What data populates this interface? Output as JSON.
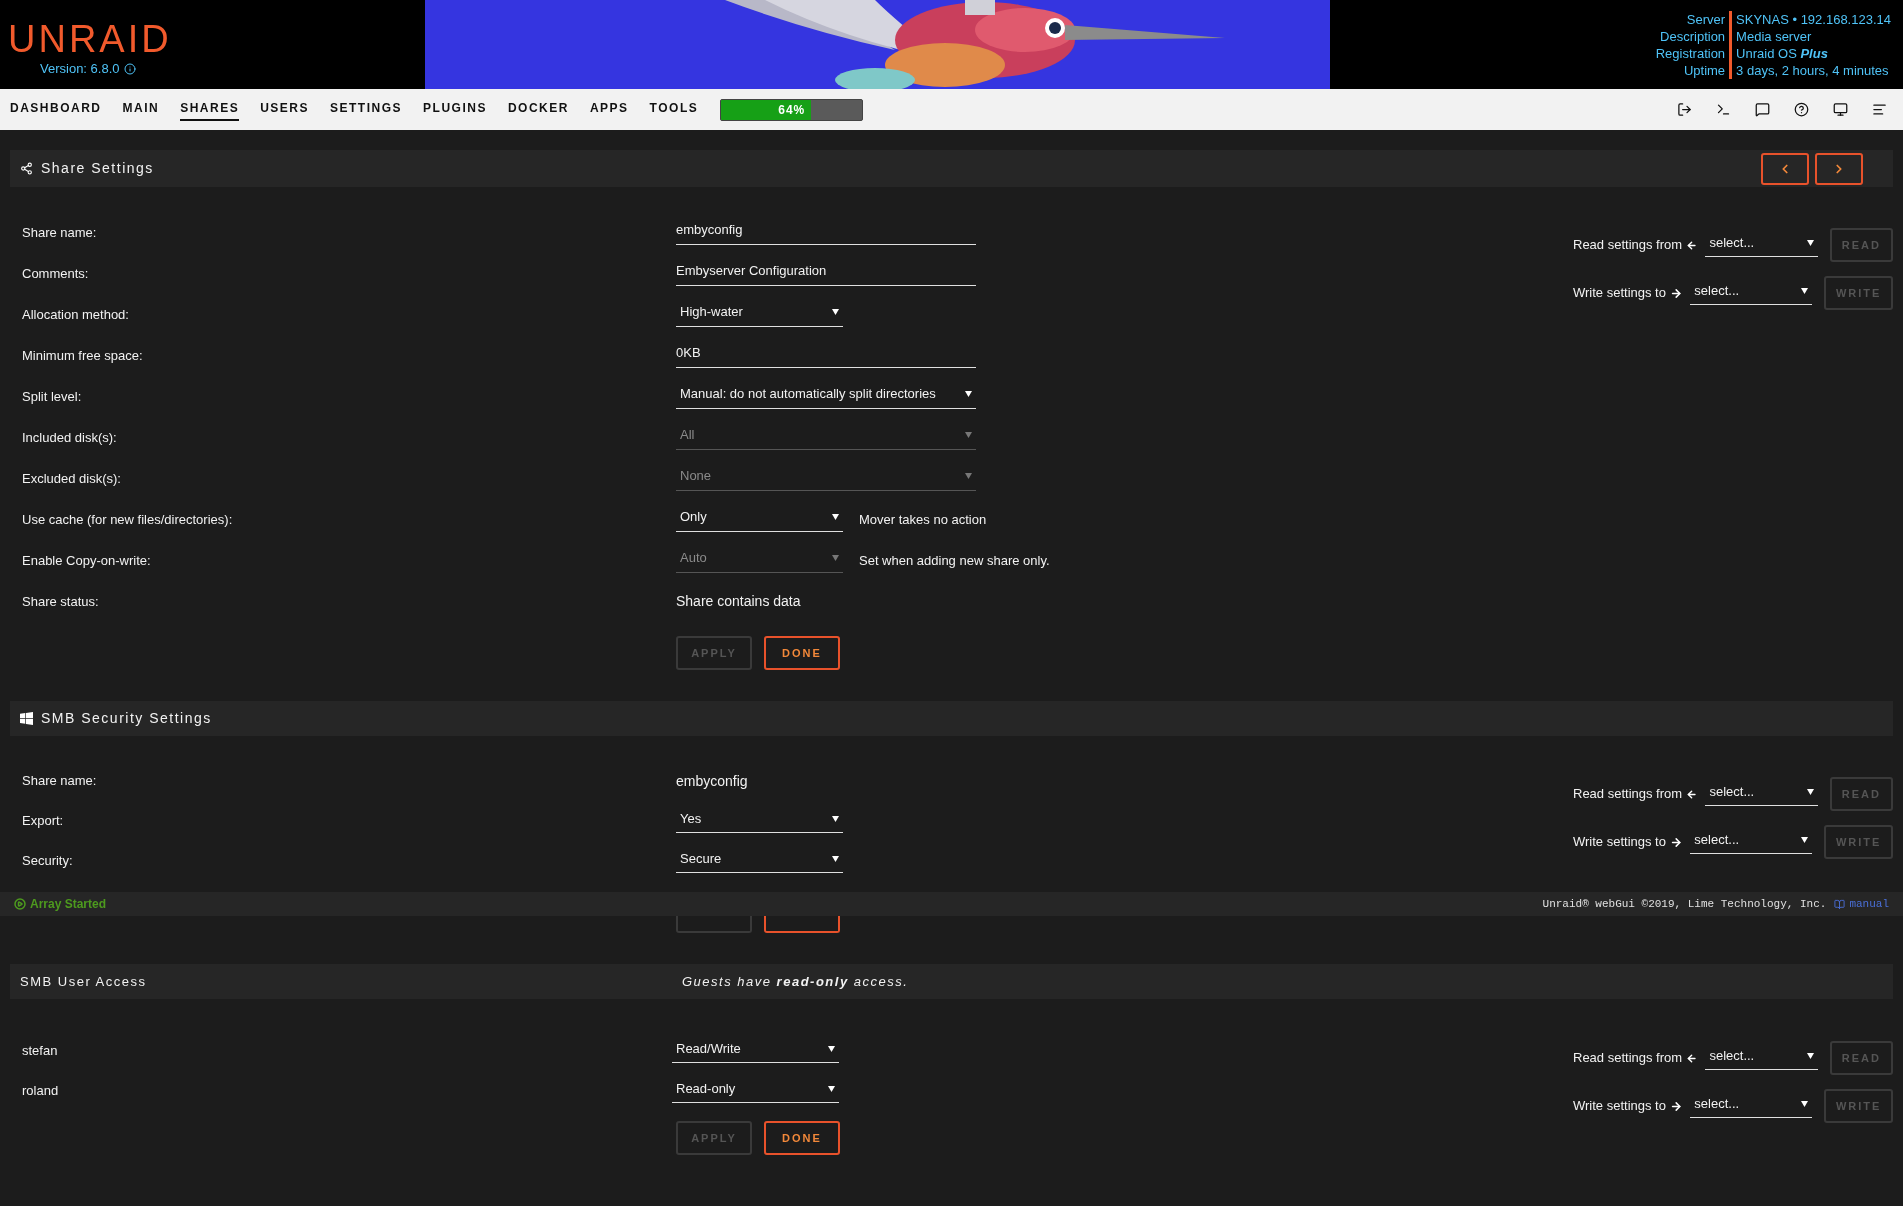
{
  "header": {
    "logo": "UNRAID",
    "version": "Version: 6.8.0",
    "server_info": [
      {
        "label": "Server",
        "value": "SKYNAS • 192.168.123.14"
      },
      {
        "label": "Description",
        "value": "Media server"
      },
      {
        "label": "Registration",
        "value": "Unraid OS **Plus**"
      },
      {
        "label": "Uptime",
        "value": "3 days, 2 hours, 4 minutes"
      }
    ]
  },
  "nav": {
    "tabs": [
      {
        "label": "DASHBOARD",
        "selected": false
      },
      {
        "label": "MAIN",
        "selected": false
      },
      {
        "label": "SHARES",
        "selected": true
      },
      {
        "label": "USERS",
        "selected": false
      },
      {
        "label": "SETTINGS",
        "selected": false
      },
      {
        "label": "PLUGINS",
        "selected": false
      },
      {
        "label": "DOCKER",
        "selected": false
      },
      {
        "label": "APPS",
        "selected": false
      },
      {
        "label": "TOOLS",
        "selected": false
      }
    ],
    "progress": {
      "label": "64%",
      "level": 0.64
    }
  },
  "share_settings": {
    "title": "Share Settings",
    "rows": [
      {
        "label": "Share name:",
        "kind": "input",
        "value": "embyconfig",
        "disabled": false
      },
      {
        "label": "Comments:",
        "kind": "input",
        "value": "Embyserver Configuration",
        "disabled": false
      },
      {
        "label": "Allocation method:",
        "kind": "select",
        "value": "High-water",
        "disabled": false
      },
      {
        "label": "Minimum free space:",
        "kind": "input",
        "value": "0KB",
        "disabled": false
      },
      {
        "label": "Split level:",
        "kind": "wide-select",
        "value": "Manual: do not automatically split directories",
        "disabled": false
      },
      {
        "label": "Included disk(s):",
        "kind": "wide-select",
        "value": "All",
        "disabled": true
      },
      {
        "label": "Excluded disk(s):",
        "kind": "wide-select",
        "value": "None",
        "disabled": true
      },
      {
        "label": "Use cache (for new files/directories):",
        "kind": "select",
        "value": "Only",
        "disabled": false,
        "note": "Mover takes no action"
      },
      {
        "label": "Enable Copy-on-write:",
        "kind": "select",
        "value": "Auto",
        "disabled": true,
        "note": "Set when adding new share only."
      },
      {
        "label": "Share status:",
        "kind": "static",
        "value": "Share contains data",
        "disabled": false
      }
    ],
    "buttons": [
      {
        "label": "APPLY",
        "disabled": true
      },
      {
        "label": "DONE",
        "disabled": false
      }
    ],
    "copy_settings": [
      {
        "label": "Read settings from",
        "kind": "read",
        "value": "select...",
        "button": "READ"
      },
      {
        "label": "Write settings to",
        "kind": "write",
        "value": "select...",
        "button": "WRITE"
      }
    ]
  },
  "smb_security": {
    "title": "SMB Security Settings",
    "rows": [
      {
        "label": "Share name:",
        "kind": "static",
        "value": "embyconfig",
        "disabled": false
      },
      {
        "label": "Export:",
        "kind": "select",
        "value": "Yes",
        "disabled": false
      },
      {
        "label": "Security:",
        "kind": "select",
        "value": "Secure",
        "disabled": false
      }
    ],
    "copy_settings": [
      {
        "label": "Read settings from",
        "kind": "read",
        "value": "select...",
        "button": "READ"
      },
      {
        "label": "Write settings to",
        "kind": "write",
        "value": "select...",
        "button": "WRITE"
      }
    ]
  },
  "footer": {
    "status": "Array Started",
    "copyright": "Unraid® webGui ©2019, Lime Technology, Inc.",
    "link": "manual"
  },
  "smb_user_access": {
    "title": "SMB User Access",
    "note": "Guests have **read-only** access.",
    "rows": [
      {
        "label": "stefan",
        "kind": "select",
        "value": "Read/Write",
        "disabled": false
      },
      {
        "label": "roland",
        "kind": "select",
        "value": "Read-only",
        "disabled": false
      }
    ],
    "buttons": [
      {
        "label": "APPLY",
        "disabled": true
      },
      {
        "label": "DONE",
        "disabled": false
      }
    ],
    "copy_settings": [
      {
        "label": "Read settings from",
        "kind": "read",
        "value": "select...",
        "button": "READ"
      },
      {
        "label": "Write settings to",
        "kind": "write",
        "value": "select...",
        "button": "WRITE"
      }
    ]
  }
}
